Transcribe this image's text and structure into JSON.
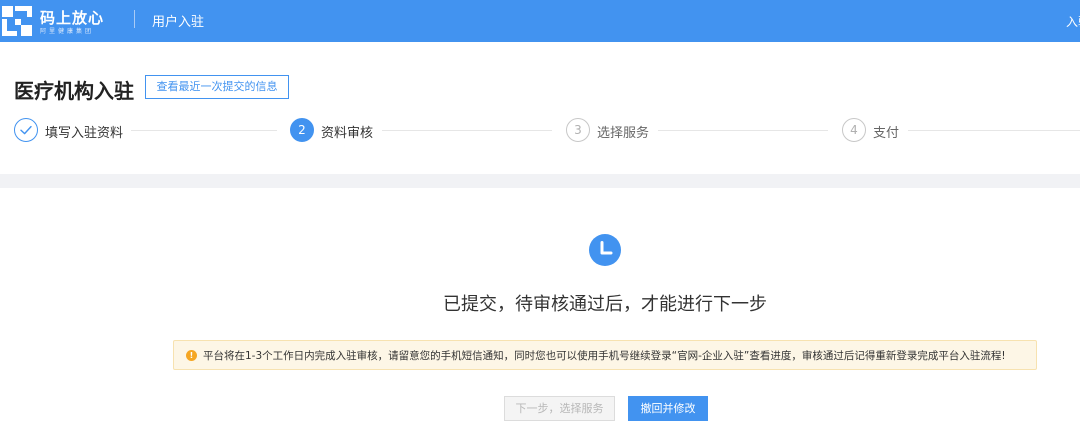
{
  "header": {
    "brand_name": "码上放心",
    "brand_subtitle": "阿里健康集团",
    "page_title": "用户入驻",
    "right_link": "入驻"
  },
  "page": {
    "title": "医疗机构入驻",
    "view_last_submission": "查看最近一次提交的信息"
  },
  "steps": [
    {
      "number": "1",
      "label": "填写入驻资料",
      "status": "done"
    },
    {
      "number": "2",
      "label": "资料审核",
      "status": "active"
    },
    {
      "number": "3",
      "label": "选择服务",
      "status": "waiting"
    },
    {
      "number": "4",
      "label": "支付",
      "status": "waiting"
    }
  ],
  "status": {
    "icon": "clock-icon",
    "message": "已提交，待审核通过后，才能进行下一步"
  },
  "notice": {
    "icon": "warning-icon",
    "text": "平台将在1-3个工作日内完成入驻审核，请留意您的手机短信通知，同时您也可以使用手机号继续登录“官网-企业入驻”查看进度，审核通过后记得重新登录完成平台入驻流程!"
  },
  "actions": {
    "next_label": "下一步，选择服务",
    "next_disabled": true,
    "withdraw_label": "撤回并修改"
  },
  "colors": {
    "primary": "#4293f0",
    "warning": "#f5a623",
    "notice_background": "#fdf6e6",
    "band": "#f1f2f5"
  }
}
